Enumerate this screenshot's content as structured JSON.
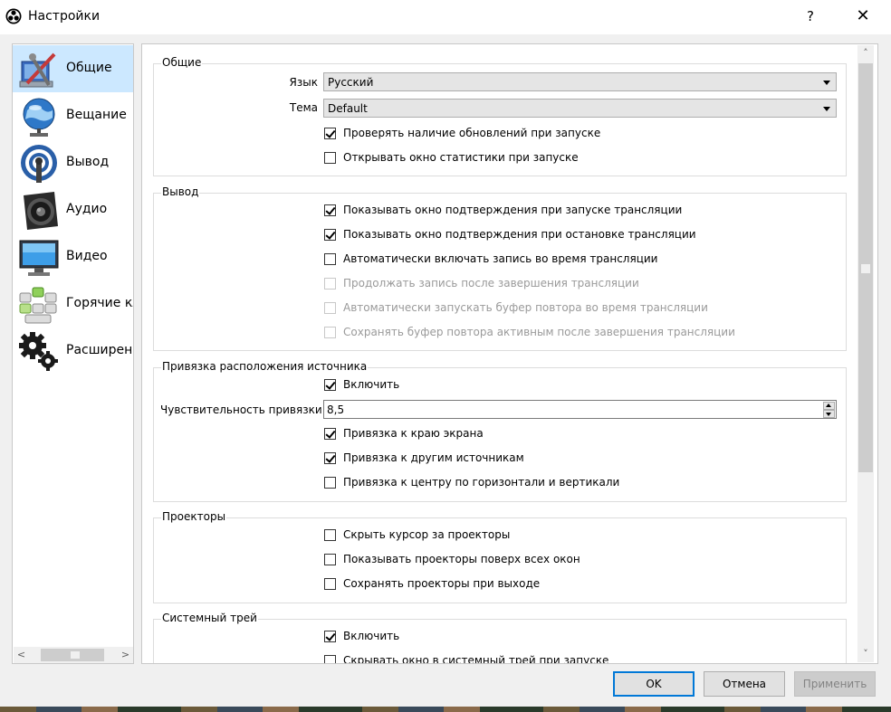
{
  "window": {
    "title": "Настройки",
    "help": "?",
    "close": "✕"
  },
  "sidebar": {
    "items": [
      {
        "label": "Общие",
        "icon": "wrench-screwdriver-icon"
      },
      {
        "label": "Вещание",
        "icon": "globe-network-icon"
      },
      {
        "label": "Вывод",
        "icon": "broadcast-antenna-icon"
      },
      {
        "label": "Аудио",
        "icon": "speaker-icon"
      },
      {
        "label": "Видео",
        "icon": "monitor-icon"
      },
      {
        "label": "Горячие кл",
        "icon": "keyboard-icon"
      },
      {
        "label": "Расширенн",
        "icon": "gears-icon"
      }
    ],
    "selected": "Общие",
    "scroll_left": "<",
    "scroll_right": ">"
  },
  "general": {
    "title": "Общие",
    "language_label": "Язык",
    "language_value": "Русский",
    "theme_label": "Тема",
    "theme_value": "Default",
    "check_updates": {
      "label": "Проверять наличие обновлений при запуске",
      "checked": true
    },
    "open_stats": {
      "label": "Открывать окно статистики при запуске",
      "checked": false
    }
  },
  "output": {
    "title": "Вывод",
    "items": [
      {
        "label": "Показывать окно подтверждения при запуске трансляции",
        "checked": true,
        "disabled": false
      },
      {
        "label": "Показывать окно подтверждения при остановке трансляции",
        "checked": true,
        "disabled": false
      },
      {
        "label": "Автоматически включать запись во время трансляции",
        "checked": false,
        "disabled": false
      },
      {
        "label": "Продолжать запись после завершения трансляции",
        "checked": false,
        "disabled": true
      },
      {
        "label": "Автоматически запускать буфер повтора во время трансляции",
        "checked": false,
        "disabled": true
      },
      {
        "label": "Сохранять буфер повтора активным после завершения трансляции",
        "checked": false,
        "disabled": true
      }
    ]
  },
  "snapping": {
    "title": "Привязка расположения источника",
    "enable": {
      "label": "Включить",
      "checked": true
    },
    "sensitivity_label": "Чувствительность привязки",
    "sensitivity_value": "8,5",
    "items": [
      {
        "label": "Привязка к краю экрана",
        "checked": true
      },
      {
        "label": "Привязка к другим источникам",
        "checked": true
      },
      {
        "label": "Привязка к центру по горизонтали и вертикали",
        "checked": false
      }
    ]
  },
  "projectors": {
    "title": "Проекторы",
    "items": [
      {
        "label": "Скрыть курсор за проекторы",
        "checked": false
      },
      {
        "label": "Показывать проекторы поверх всех окон",
        "checked": false
      },
      {
        "label": "Сохранять проекторы при выходе",
        "checked": false
      }
    ]
  },
  "tray": {
    "title": "Системный трей",
    "items": [
      {
        "label": "Включить",
        "checked": true
      },
      {
        "label": "Скрывать окно в системный трей при запуске",
        "checked": false
      }
    ]
  },
  "buttons": {
    "ok": "OK",
    "cancel": "Отмена",
    "apply": "Применить"
  }
}
